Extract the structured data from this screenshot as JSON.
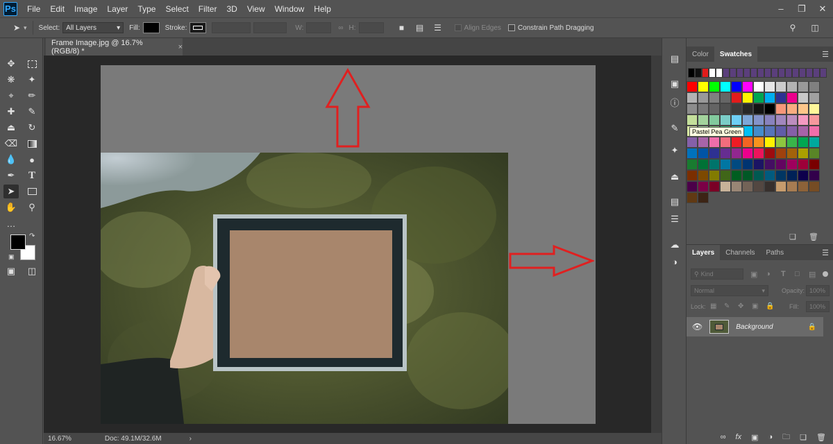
{
  "app": {
    "logo": "Ps"
  },
  "menu": [
    "File",
    "Edit",
    "Image",
    "Layer",
    "Type",
    "Select",
    "Filter",
    "3D",
    "View",
    "Window",
    "Help"
  ],
  "window_controls": [
    "minimize-icon",
    "restore-icon",
    "close-icon"
  ],
  "options": {
    "select_label": "Select:",
    "select_value": "All Layers",
    "fill_label": "Fill:",
    "stroke_label": "Stroke:",
    "w_label": "W:",
    "h_label": "H:",
    "align_edges": "Align Edges",
    "constrain": "Constrain Path Dragging",
    "fill_color": "#000000"
  },
  "document": {
    "tab_title": "Frame Image.jpg @ 16.7% (RGB/8) *",
    "tab_close": "×",
    "zoom": "16.67%",
    "doc_size": "Doc: 49.1M/32.6M",
    "status_arrow": "›"
  },
  "colors": {
    "foreground": "#000000",
    "background": "#ffffff",
    "arrow": "#e02020"
  },
  "swatch_panel": {
    "tabs": [
      "Color",
      "Swatches"
    ],
    "active_tab": "Swatches",
    "tooltip": "Pastel Pea Green",
    "recent": [
      "#000000",
      "#111111",
      "#e11b1b",
      "#ffffff",
      "#ffffff",
      "#5b3f7c",
      "#5b3f7c",
      "#5b3f7c",
      "#5b3f7c",
      "#5b3f7c",
      "#5b3f7c",
      "#5b3f7c",
      "#5b3f7c",
      "#5b3f7c",
      "#5b3f7c",
      "#5b3f7c",
      "#5b3f7c",
      "#5b3f7c",
      "#5b3f7c",
      "#5b3f7c"
    ],
    "rows": [
      [
        "#ff0000",
        "#ffff00",
        "#00ff00",
        "#00ffff",
        "#0000ff",
        "#ff00ff",
        "#ffffff",
        "#e6e6e6",
        "#cccccc",
        "#b3b3b3",
        "#999999",
        "#808080"
      ],
      [
        "#b3b3b3",
        "#999999",
        "#808080",
        "#666666",
        "#e11b1b",
        "#fff200",
        "#00a651",
        "#00aeef",
        "#2e3192",
        "#ec008c",
        "#c8c8c8",
        "#a0a0a0"
      ],
      [
        "#8c8c8c",
        "#787878",
        "#646464",
        "#505050",
        "#3c3c3c",
        "#282828",
        "#141414",
        "#000000",
        "#f7977a",
        "#f9ad81",
        "#fdc68a",
        "#fff79a"
      ],
      [
        "#c4df9b",
        "#a3d39c",
        "#82ca9d",
        "#7bcdc8",
        "#6ecff6",
        "#7ea7d8",
        "#8493ca",
        "#8882be",
        "#a187be",
        "#bc8dbf",
        "#f49ac2",
        "#f6989d"
      ],
      [
        "#d7e8a2",
        "#a2d39c",
        "#7cc576",
        "#3cb878",
        "#1cbbb4",
        "#00bff3",
        "#448ccb",
        "#5674b9",
        "#605ca8",
        "#855fa8",
        "#a763a8",
        "#f06eaa"
      ],
      [
        "#8560a8",
        "#a864a8",
        "#f06eaa",
        "#f26d7d",
        "#ed1c24",
        "#f26522",
        "#f7941d",
        "#fff200",
        "#8dc63f",
        "#39b54a",
        "#00a651",
        "#00a99d"
      ],
      [
        "#0072bc",
        "#0054a6",
        "#2e3192",
        "#662d91",
        "#92278f",
        "#ec008c",
        "#ed145b",
        "#9e0b0f",
        "#a0410d",
        "#a3620a",
        "#aba000",
        "#598527"
      ],
      [
        "#197b30",
        "#007236",
        "#00746b",
        "#0076a3",
        "#004a80",
        "#003471",
        "#1b1464",
        "#440e62",
        "#630460",
        "#9e005d",
        "#9e0039",
        "#790000"
      ],
      [
        "#7b2e00",
        "#7d4900",
        "#827b00",
        "#406618",
        "#005e20",
        "#005826",
        "#005952",
        "#005b7f",
        "#003663",
        "#002157",
        "#0d004c",
        "#32004b"
      ],
      [
        "#4b0049",
        "#7b0046",
        "#7a0026",
        "#c7b299",
        "#998675",
        "#736357",
        "#534741",
        "#37302d",
        "#c69c6d",
        "#a67c52",
        "#8c6239",
        "#754c24"
      ],
      [
        "#603913",
        "#3c2415"
      ]
    ]
  },
  "layers_panel": {
    "tabs": [
      "Layers",
      "Channels",
      "Paths"
    ],
    "active_tab": "Layers",
    "kind": "Kind",
    "blend": "Normal",
    "opacity_label": "Opacity:",
    "opacity_value": "100%",
    "lock_label": "Lock:",
    "fill_label": "Fill:",
    "fill_value": "100%",
    "layer_name": "Background",
    "footer_icons": [
      "link-icon",
      "fx-icon",
      "mask-icon",
      "adjustment-icon",
      "folder-icon",
      "new-layer-icon",
      "trash-icon"
    ]
  },
  "tools": [
    "move",
    "marquee",
    "lasso",
    "magic-wand",
    "crop",
    "eyedropper",
    "healing",
    "brush",
    "stamp",
    "history-brush",
    "eraser",
    "gradient",
    "blur",
    "dodge",
    "pen",
    "type",
    "path-select",
    "shape",
    "hand",
    "zoom",
    "more",
    "quick-mask",
    "screen-mode"
  ]
}
